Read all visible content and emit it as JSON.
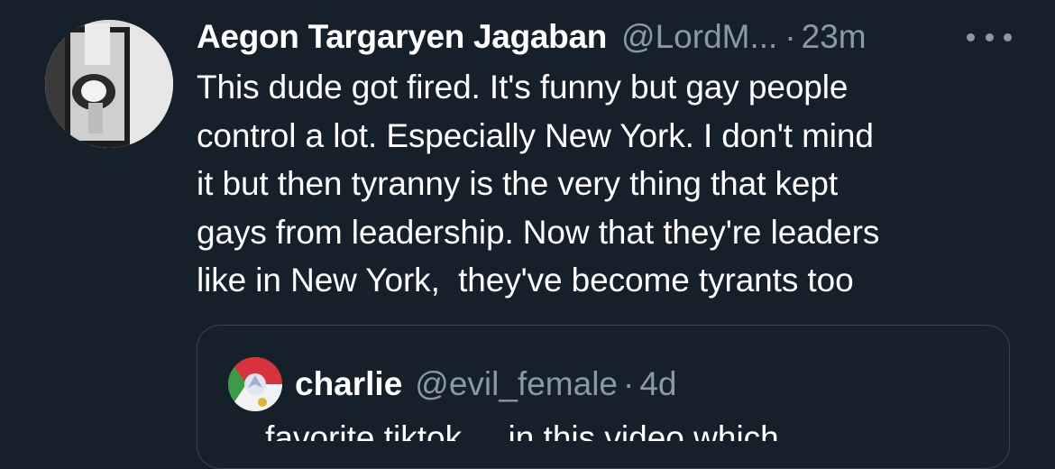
{
  "tweet": {
    "author": {
      "display_name": "Aegon Targaryen Jagaban",
      "handle": "@LordM...",
      "separator": "·",
      "time": "23m"
    },
    "more_icon": "more-horizontal-icon",
    "text": "This dude got fired. It's funny but gay people\ncontrol a lot. Especially New York. I don't mind\nit but then tyranny is the very thing that kept\ngays from leadership. Now that they're leaders\nlike in New York,  they've become tyrants too"
  },
  "quoted_tweet": {
    "author": {
      "display_name": "charlie",
      "handle": "@evil_female",
      "separator": "·",
      "time": "4d"
    },
    "text_partial": "... favorite tiktok ... in this video which"
  },
  "colors": {
    "background": "#15202b",
    "primary_text": "#ffffff",
    "secondary_text": "#8b98a5",
    "border": "#38444d"
  }
}
